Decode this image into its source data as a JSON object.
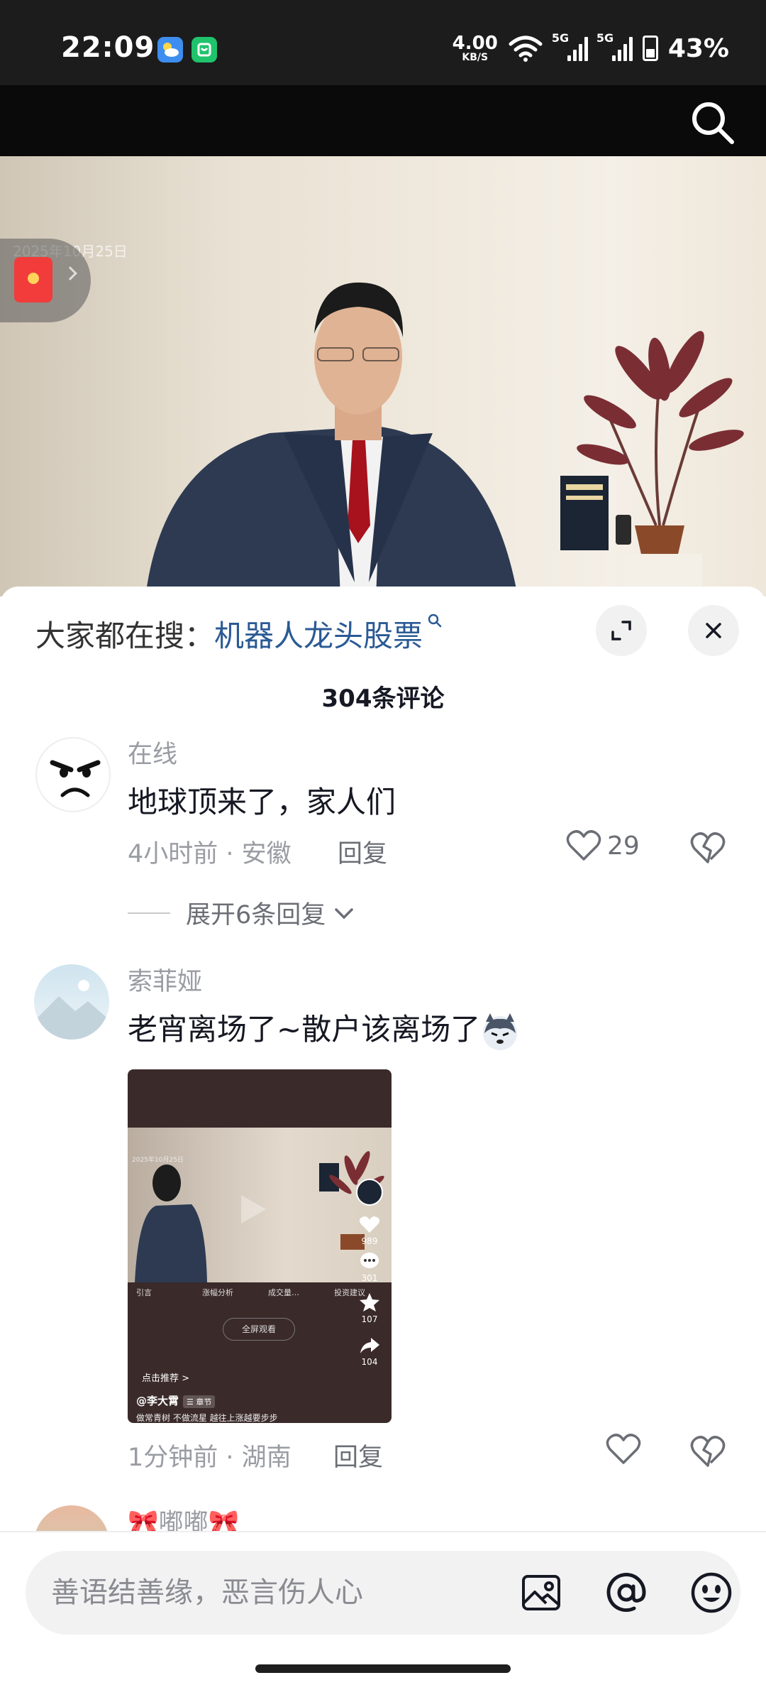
{
  "status_bar": {
    "time": "22:09",
    "net_speed_value": "4.00",
    "net_speed_unit": "KB/S",
    "signal1_label": "5G",
    "signal2_label": "5G",
    "battery": "43%"
  },
  "video": {
    "date_overlay": "2025年10月25日"
  },
  "sheet": {
    "trending_prefix": "大家都在搜：",
    "trending_keyword": "机器人龙头股票",
    "comments_count": "304条评论"
  },
  "comments": [
    {
      "username": "在线",
      "text": "地球顶来了，家人们",
      "time_location": "4小时前 · 安徽",
      "reply_label": "回复",
      "likes": "29",
      "expand_replies": "展开6条回复"
    },
    {
      "username": "索菲娅",
      "text": "老宵离场了~散户该离场了",
      "time_location": "1分钟前 · 湖南",
      "reply_label": "回复",
      "likes": "",
      "attachment": {
        "date": "2025年10月25日",
        "chapters": [
          "引言",
          "涨幅分析",
          "成交量…",
          "投资建议"
        ],
        "fullscreen_label": "全屏观看",
        "likes": "989",
        "comments": "301",
        "favorites": "107",
        "shares": "104",
        "recommend_label": "点击推荐 >",
        "author": "@李大霄",
        "author_tag": "☰ 章节",
        "caption": "做常青树 不做流星 越往上涨越要步步"
      }
    },
    {
      "username": "🎀嘟嘟🎀"
    }
  ],
  "input": {
    "placeholder": "善语结善缘，恶言伤人心"
  },
  "colors": {
    "keyword": "#2a5a94",
    "gray_text": "#9a9ca3",
    "body_text": "#161823"
  }
}
